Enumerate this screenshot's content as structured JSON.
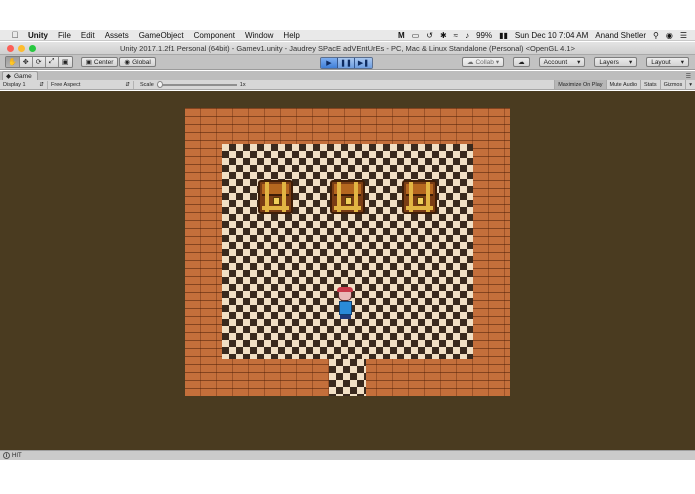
{
  "menubar": {
    "app_name": "Unity",
    "items": [
      "File",
      "Edit",
      "Assets",
      "GameObject",
      "Component",
      "Window",
      "Help"
    ],
    "battery": "99%",
    "clock": "Sun Dec 10  7:04 AM",
    "user": "Anand Shetler"
  },
  "window": {
    "title": "Unity 2017.1.2f1 Personal (64bit) - Gamev1.unity - Jaudrey SPacE adVEntUrEs - PC, Mac & Linux Standalone (Personal) <OpenGL 4.1>"
  },
  "toolbar": {
    "pivot_label": "Center",
    "space_label": "Global",
    "collab_label": "Collab",
    "account_label": "Account",
    "layers_label": "Layers",
    "layout_label": "Layout"
  },
  "game_view": {
    "tab_label": "Game",
    "display_label": "Display 1",
    "aspect_label": "Free Aspect",
    "scale_label": "Scale",
    "scale_value": "1x",
    "buttons": [
      "Maximize On Play",
      "Mute Audio",
      "Stats",
      "Gizmos"
    ]
  },
  "statusbar": {
    "message": "HIT"
  },
  "colors": {
    "background": "#4a3b20",
    "wall_brick": "#c46f3b",
    "floor_light": "#f1dfc4",
    "floor_dark": "#3a2a1e",
    "play_accent": "#3f7fd8"
  },
  "sprites": [
    "treasure-chest",
    "treasure-chest",
    "treasure-chest",
    "player-character"
  ]
}
